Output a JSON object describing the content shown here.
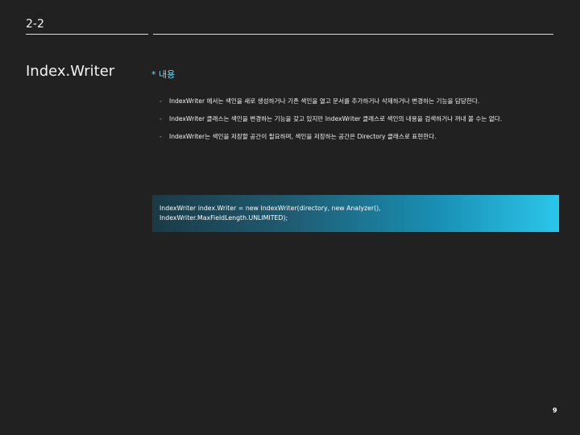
{
  "header": {
    "section_number": "2-2",
    "title": "Index.Writer"
  },
  "content": {
    "heading": "* 내용",
    "bullets": [
      {
        "marker": "-",
        "text": "IndexWriter 에서는 색인을 새로 생성하거나 기존 색인을 열고 문서를 추가하거나 삭제하거나 변경하는 기능을 담당한다."
      },
      {
        "marker": "-",
        "text": "IndexWriter 클래스는 색인을 변경하는 기능을 갖고 있지만 IndexWriter 클래스로 색인의 내용을 검색하거나 꺼내 볼 수는 없다."
      },
      {
        "marker": "-",
        "text": "IndexWriter는 색인을 저장할 공간이 필요하며, 색인을 저장하는 공간은 Directory 클래스로 표현한다."
      }
    ],
    "code_lines": [
      "IndexWriter index.Writer = new IndexWriter(directory, new Analyzer(),",
      "IndexWriter.MaxFieldLength.UNLIMITED);"
    ]
  },
  "footer": {
    "page_number": "9"
  },
  "colors": {
    "background": "#212121",
    "heading_accent": "#7fd4f0",
    "code_gradient_start": "#1a3a46",
    "code_gradient_end": "#2bc6ea"
  }
}
